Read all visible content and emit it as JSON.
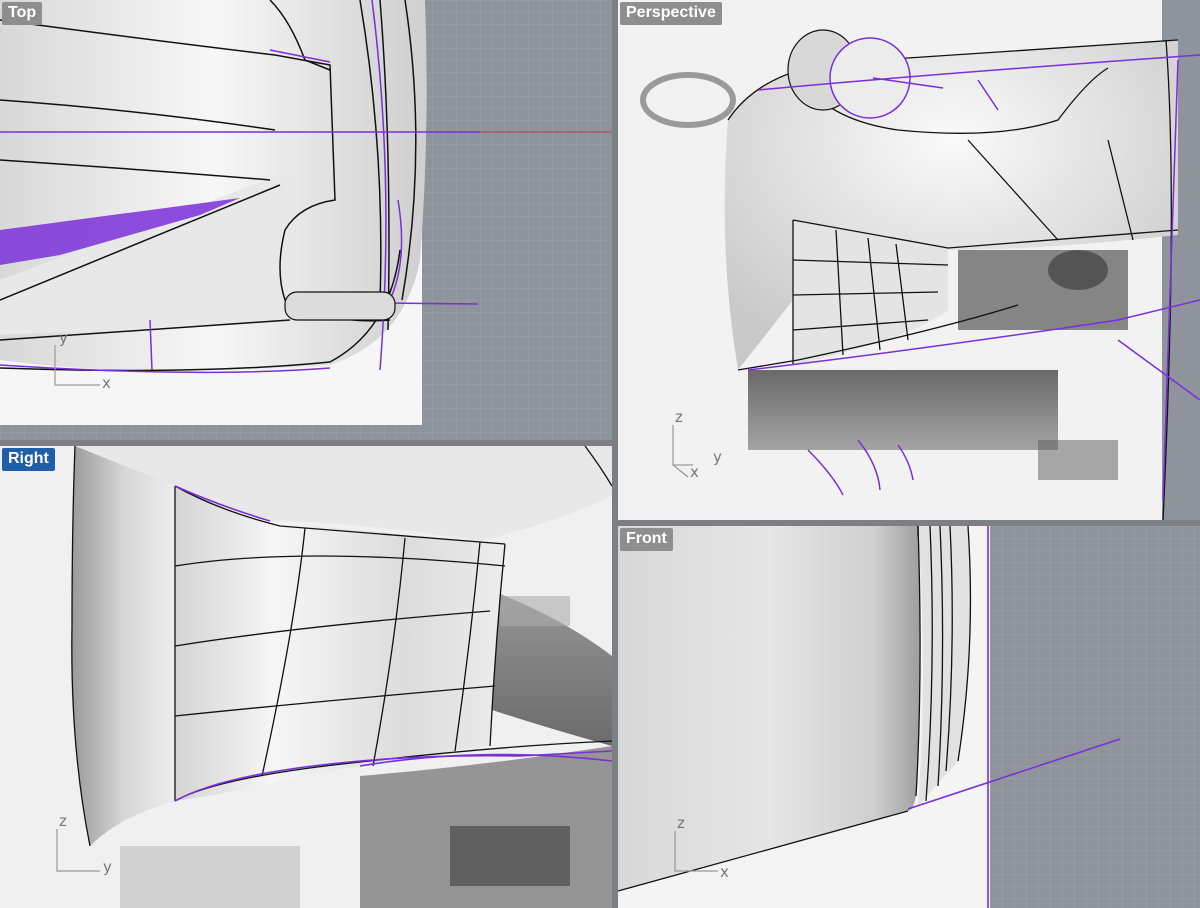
{
  "viewports": {
    "top": {
      "label": "Top",
      "axis_x": "x",
      "axis_y": "y"
    },
    "perspective": {
      "label": "Perspective",
      "axis_z": "z",
      "axis_y": "y",
      "axis_x": "x"
    },
    "right": {
      "label": "Right",
      "axis_z": "z",
      "axis_y": "y",
      "active": true
    },
    "front": {
      "label": "Front",
      "axis_z": "z",
      "axis_x": "x"
    }
  },
  "colors": {
    "curve": "#7a2fd8",
    "edge": "#111111",
    "grid_bg": "#8f939b",
    "active_label": "#1f5fa8",
    "inactive_label": "#8e8e8e"
  }
}
